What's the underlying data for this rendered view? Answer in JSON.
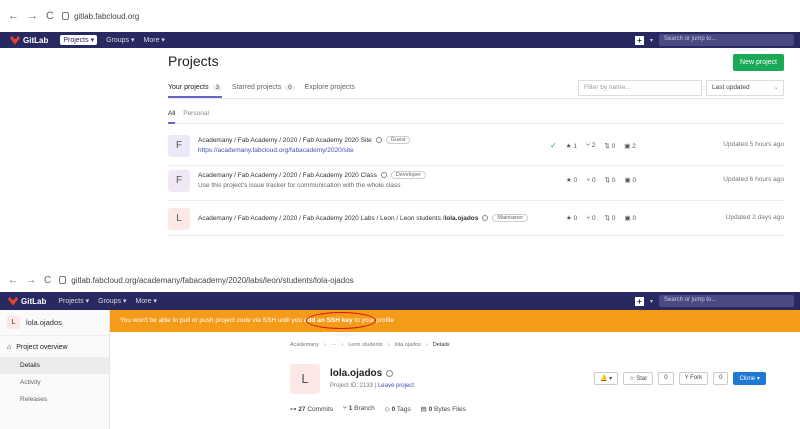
{
  "shot1": {
    "browser": {
      "back": "←",
      "forward": "→",
      "reload": "C",
      "url": "gitlab.fabcloud.org"
    },
    "nav": {
      "logo": "GitLab",
      "items": [
        {
          "label": "Projects ▾"
        },
        {
          "label": "Groups ▾"
        },
        {
          "label": "More ▾"
        }
      ],
      "plus": "+ ▾",
      "search_placeholder": "Search or jump to..."
    },
    "title": "Projects",
    "new_project": "New project",
    "tabs": [
      {
        "label": "Your projects",
        "count": "3"
      },
      {
        "label": "Starred projects",
        "count": "0"
      },
      {
        "label": "Explore projects",
        "count": ""
      }
    ],
    "filter_placeholder": "Filter by name...",
    "sort": "Last updated",
    "subtabs": [
      "All",
      "Personal"
    ],
    "projects": [
      {
        "avatar": "F",
        "avatar_color": "#e9e9f7",
        "name": "Academany / Fab Academy / 2020 / Fab Academy 2020 Site",
        "role": "Guest",
        "desc": "https://academany.fabcloud.org/fabacademy/2020/site",
        "stars": "1",
        "forks": "2",
        "mrs": "0",
        "issues": "2",
        "updated": "Updated 5 hours ago"
      },
      {
        "avatar": "F",
        "avatar_color": "#f1e8f7",
        "name": "Academany / Fab Academy / 2020 / Fab Academy 2020 Class",
        "role": "Developer",
        "desc": "Use this project's issue tracker for communication with the whole class",
        "stars": "0",
        "forks": "0",
        "mrs": "0",
        "issues": "0",
        "updated": "Updated 6 hours ago"
      },
      {
        "avatar": "L",
        "avatar_color": "#fde8e8",
        "name_prefix": "Academany / Fab Academy / 2020 / Fab Academy 2020 Labs / Leon / Leon students / ",
        "name_bold": "lola.ojados",
        "role": "Maintainer",
        "stars": "0",
        "forks": "0",
        "mrs": "0",
        "issues": "0",
        "updated": "Updated 2 days ago"
      }
    ]
  },
  "shot2": {
    "browser": {
      "back": "←",
      "forward": "→",
      "reload": "C",
      "url": "gitlab.fabcloud.org/academany/fabacademy/2020/labs/leon/students/lola-ojados"
    },
    "nav": {
      "logo": "GitLab",
      "items": [
        {
          "label": "Projects ▾"
        },
        {
          "label": "Groups ▾"
        },
        {
          "label": "More ▾"
        }
      ],
      "plus": "+ ▾",
      "search_placeholder": "Search or jump to..."
    },
    "sidebar": {
      "avatar": "L",
      "project": "lola.ojados",
      "overview": "Project overview",
      "items": [
        "Details",
        "Activity",
        "Releases"
      ]
    },
    "banner": {
      "before": "You won't be able to pull or push project code via SSH until you ",
      "link": "add an SSH key",
      "after": " to your profile"
    },
    "breadcrumbs": [
      "Academany",
      "···",
      "Leon students",
      "lola.ojados",
      "Details"
    ],
    "project": {
      "avatar": "L",
      "name": "lola.ojados",
      "id": "Project ID: 2133",
      "leave": "Leave project",
      "buttons": [
        "🔔 ▾",
        "☆ Star",
        "0",
        "Y Fork",
        "0",
        "Clone ▾"
      ],
      "commits": {
        "num": "27",
        "label": "Commits"
      },
      "branches": {
        "num": "1",
        "label": "Branch"
      },
      "tags": {
        "num": "0",
        "label": "Tags"
      },
      "files": {
        "num": "0",
        "label": "Bytes Files"
      }
    }
  }
}
